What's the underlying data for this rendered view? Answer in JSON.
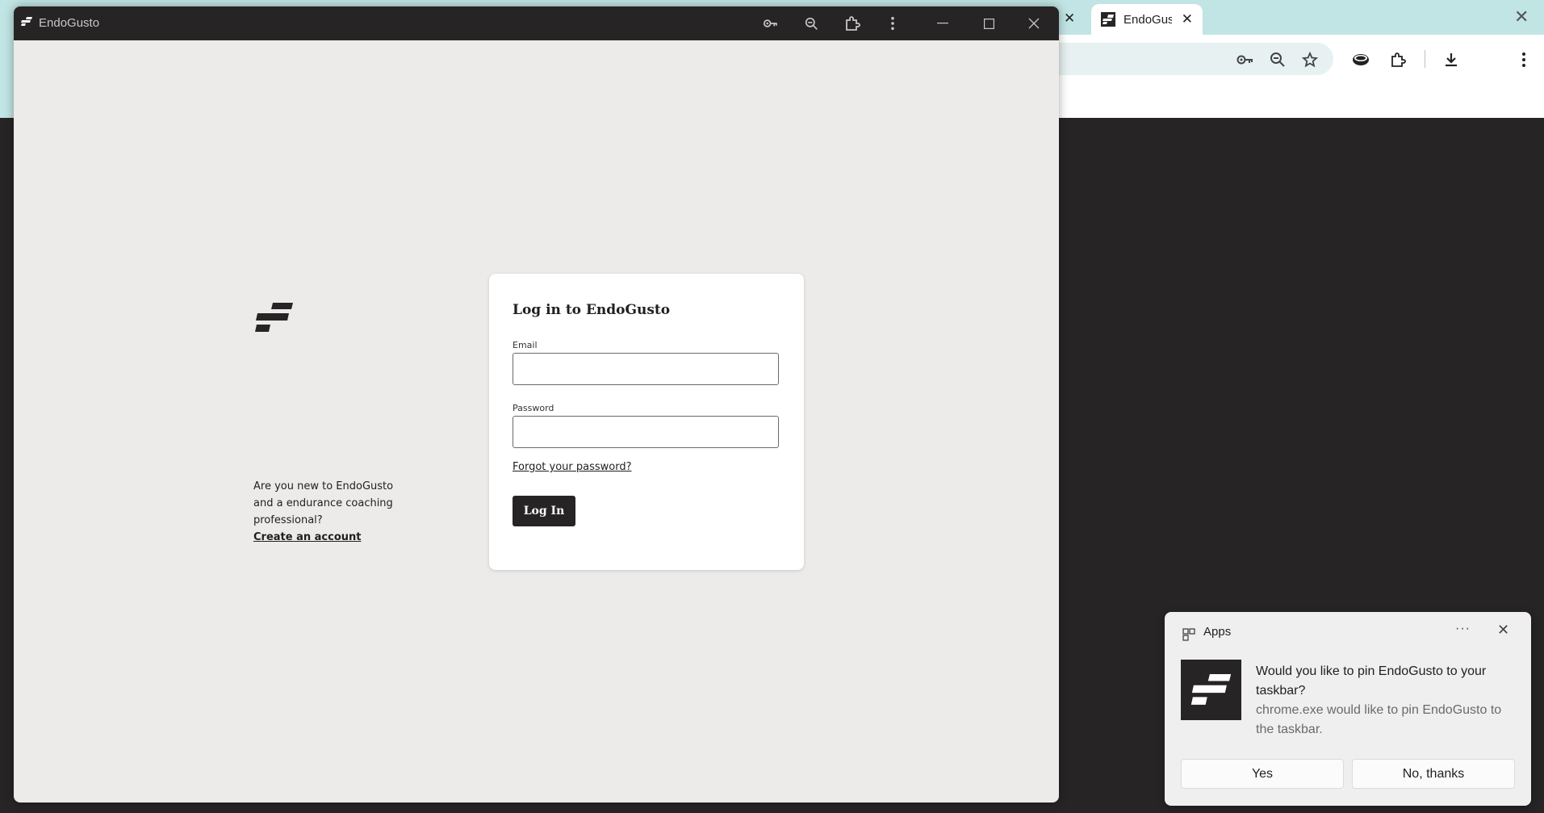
{
  "background_browser": {
    "tab_label": "EndoGusto"
  },
  "app_window": {
    "title": "EndoGusto",
    "toolbar_icons": [
      "key-icon",
      "zoom-icon",
      "extension-icon",
      "more-vert-icon"
    ],
    "window_controls": [
      "minimize-icon",
      "maximize-icon",
      "close-icon"
    ]
  },
  "intro": {
    "text": "Are you new to EndoGusto and a endurance coaching professional?",
    "create_account": "Create an account"
  },
  "login": {
    "title": "Log in to EndoGusto",
    "email_label": "Email",
    "email_value": "",
    "password_label": "Password",
    "password_value": "",
    "forgot_password": "Forgot your password?",
    "submit": "Log In"
  },
  "notification": {
    "app": "Apps",
    "more": "···",
    "message": "Would you like to pin EndoGusto to your taskbar?",
    "sub": "chrome.exe would like to pin EndoGusto to the taskbar.",
    "yes": "Yes",
    "no": "No, thanks"
  },
  "colors": {
    "brand_dark": "#272425",
    "page_bg": "#ecebe9",
    "chrome_teal": "#c1e5e4"
  }
}
